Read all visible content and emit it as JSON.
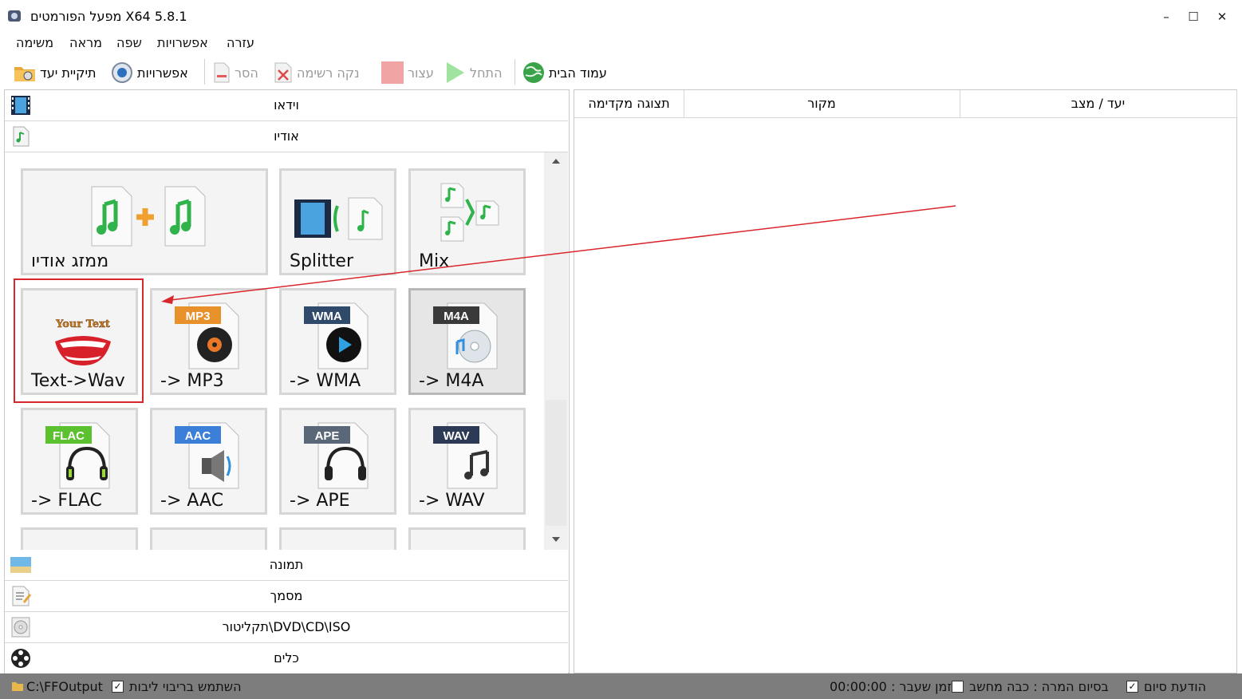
{
  "window": {
    "title": "מפעל הפורמטים X64 5.8.1",
    "minimize": "–",
    "maximize": "☐",
    "close": "✕"
  },
  "menu": [
    "עזרה",
    "אפשרויות",
    "שפה",
    "מראה",
    "משימה"
  ],
  "toolbar": {
    "home": "עמוד הבית",
    "start": "התחל",
    "stop": "עצור",
    "clear": "נקה רשימה",
    "remove": "הסר",
    "options": "אפשרויות",
    "output_folder": "תיקיית יעד"
  },
  "categories": {
    "video": "וידאו",
    "audio": "אודיו",
    "picture": "תמונה",
    "document": "מסמך",
    "rom": "תקליטור\\DVD\\CD\\ISO",
    "tools": "כלים"
  },
  "tiles": {
    "joiner": "ממזג אודיו",
    "splitter": "Splitter",
    "mix": "Mix",
    "text_wav": "Text->Wav",
    "mp3": "-> MP3",
    "wma": "-> WMA",
    "m4a": "-> M4A",
    "flac": "-> FLAC",
    "aac": "-> AAC",
    "ape": "-> APE",
    "wav": "-> WAV"
  },
  "badges": {
    "mp3": "MP3",
    "wma": "WMA",
    "m4a": "M4A",
    "flac": "FLAC",
    "aac": "AAC",
    "ape": "APE",
    "wav": "WAV",
    "your_text": "Your Text"
  },
  "badge_colors": {
    "mp3": "#e8902a",
    "wma": "#2f4a6b",
    "m4a": "#3a3a3a",
    "flac": "#5cc12f",
    "aac": "#3b7fd8",
    "ape": "#5a6778",
    "wav": "#2c3a55"
  },
  "table": {
    "columns": [
      "יעד / מצב",
      "מקור",
      "תצוגה מקדימה"
    ]
  },
  "status": {
    "output_path": "C:\\FFOutput",
    "use_multithread": "השתמש בריבוי ליבות",
    "use_multithread_checked": true,
    "elapsed": "00:00:00 : זמן שעבר",
    "shutdown": "בסיום המרה : כבה מחשב",
    "shutdown_checked": false,
    "notify": "הודעת סיום",
    "notify_checked": true
  },
  "annotation": {
    "highlight_color": "#d9262c"
  }
}
